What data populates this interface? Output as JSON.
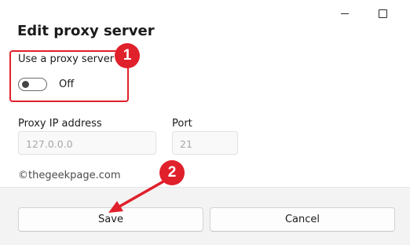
{
  "dialog": {
    "title": "Edit proxy server",
    "titlebar": {
      "minimize_icon": "minimize-icon",
      "maximize_icon": "maximize-icon"
    }
  },
  "proxy_toggle": {
    "label": "Use a proxy server",
    "state_label": "Off",
    "on": false
  },
  "proxy_ip": {
    "label": "Proxy IP address",
    "placeholder": "127.0.0.0"
  },
  "port": {
    "label": "Port",
    "placeholder": "21"
  },
  "watermark": "©thegeekpage.com",
  "buttons": {
    "save": "Save",
    "cancel": "Cancel"
  },
  "annotations": {
    "badge1": "1",
    "badge2": "2",
    "color": "#e0202b"
  }
}
